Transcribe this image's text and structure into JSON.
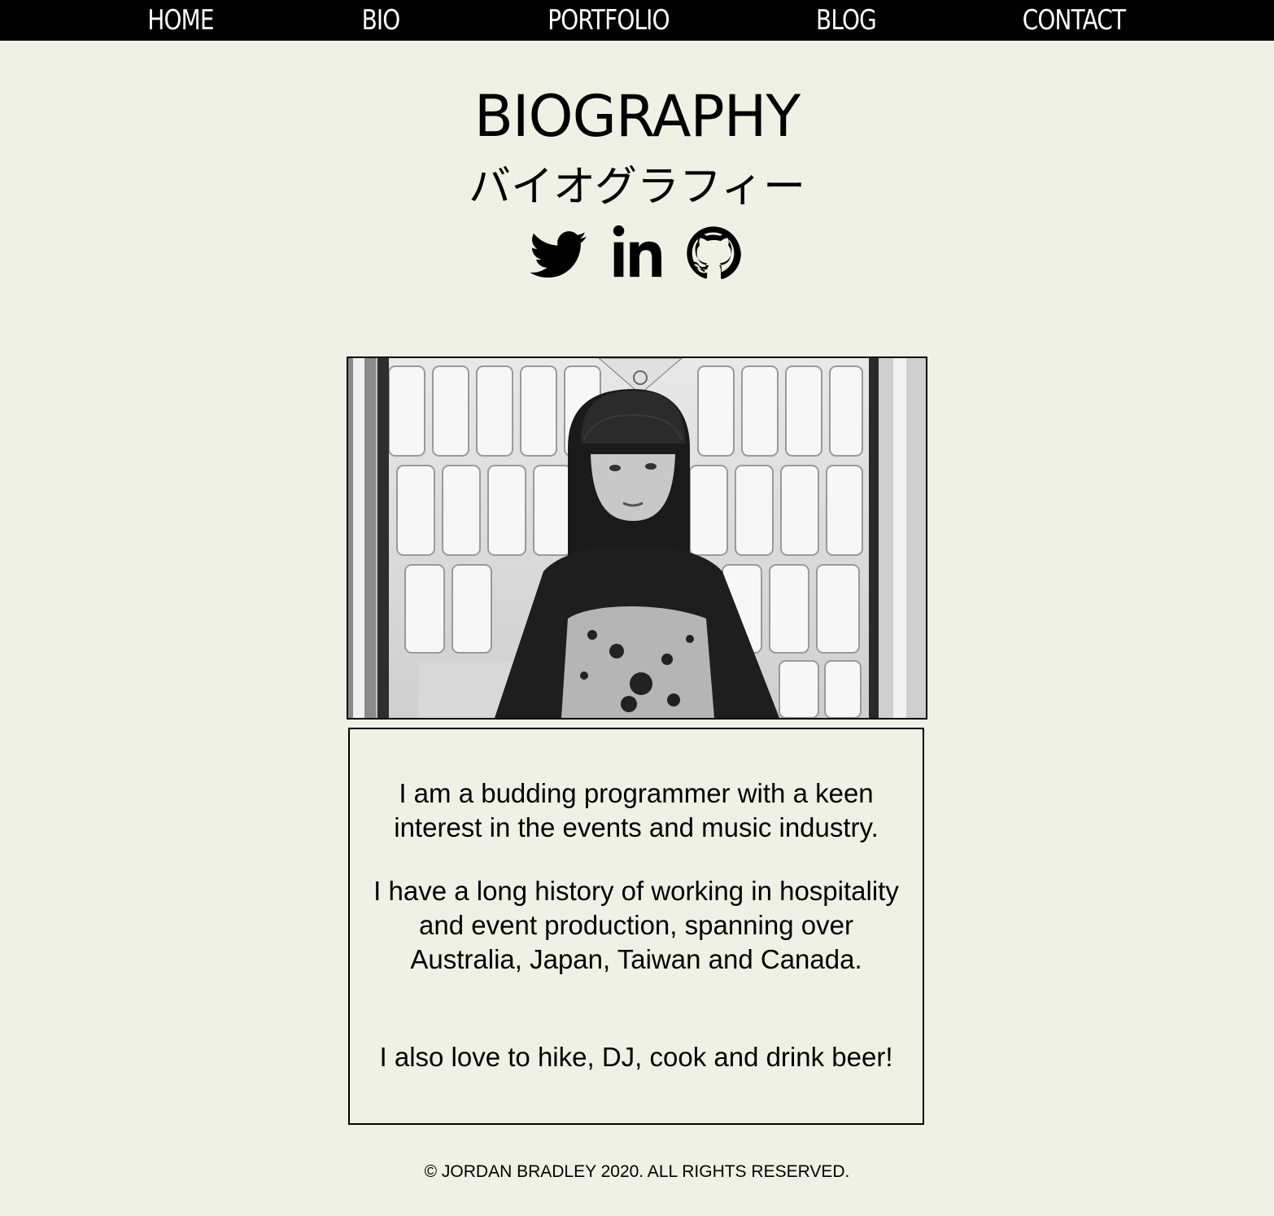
{
  "nav": {
    "items": [
      {
        "label": "HOME"
      },
      {
        "label": "BIO"
      },
      {
        "label": "PORTFOLIO"
      },
      {
        "label": "BLOG"
      },
      {
        "label": "CONTACT"
      }
    ]
  },
  "header": {
    "title": "BIOGRAPHY",
    "subtitle": "バイオグラフィー"
  },
  "socials": {
    "items": [
      {
        "icon": "twitter-icon"
      },
      {
        "icon": "linkedin-icon"
      },
      {
        "icon": "github-icon"
      }
    ]
  },
  "bio": {
    "paragraphs": [
      "I am a budding programmer with a keen interest in the events and music industry.",
      "I have a long history of working in hospitality and event production, spanning over Australia, Japan, Taiwan and Canada.",
      "I also love to hike, DJ, cook and drink beer!"
    ]
  },
  "footer": {
    "text": "© JORDAN BRADLEY 2020. ALL RIGHTS RESERVED."
  },
  "colors": {
    "background": "#eff1e4",
    "nav_background": "#000000",
    "nav_text": "#ffffff",
    "text": "#000000"
  }
}
